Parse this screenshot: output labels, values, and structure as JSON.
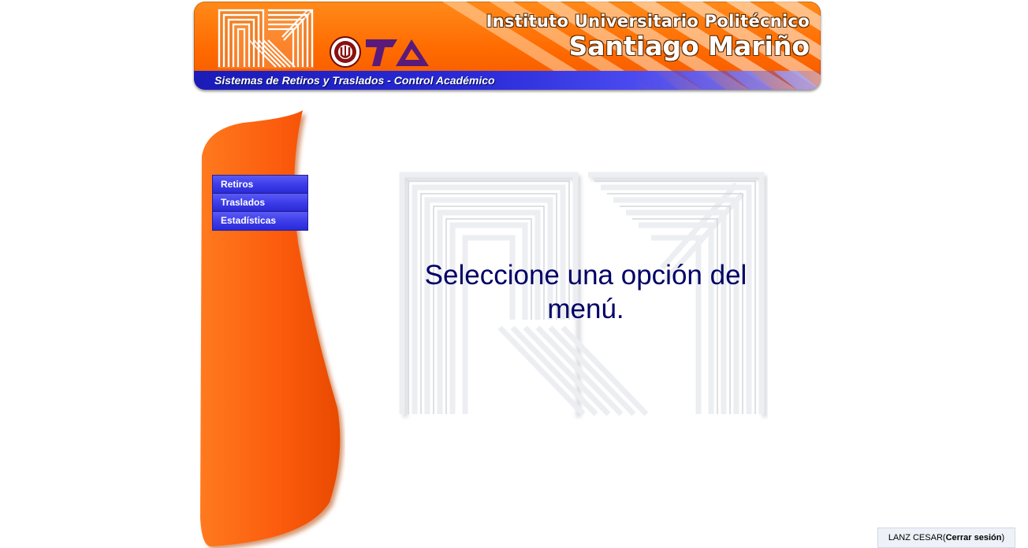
{
  "header": {
    "institution_line1": "Instituto Universitario Politécnico",
    "institution_line2": "Santiago Mariño",
    "subtitle": "Sistemas de Retiros y Traslados - Control Académico"
  },
  "menu": {
    "items": [
      {
        "label": "Retiros"
      },
      {
        "label": "Traslados"
      },
      {
        "label": "Estadísticas"
      }
    ]
  },
  "main": {
    "message": "Seleccione una opción del menú."
  },
  "session": {
    "user": "LANZ CESAR",
    "open_paren": " (",
    "logout_label": "Cerrar sesión",
    "close_paren": ")"
  },
  "colors": {
    "banner_orange": "#ff6a00",
    "banner_blue": "#2a2ad8",
    "menu_blue": "#3b3be8",
    "side_orange": "#fb5a0c",
    "message_text": "#000066"
  },
  "icons": {
    "logo": "iupsm-logo-icon",
    "seal": "university-seal-icon",
    "ota": "ota-logo-icon"
  }
}
